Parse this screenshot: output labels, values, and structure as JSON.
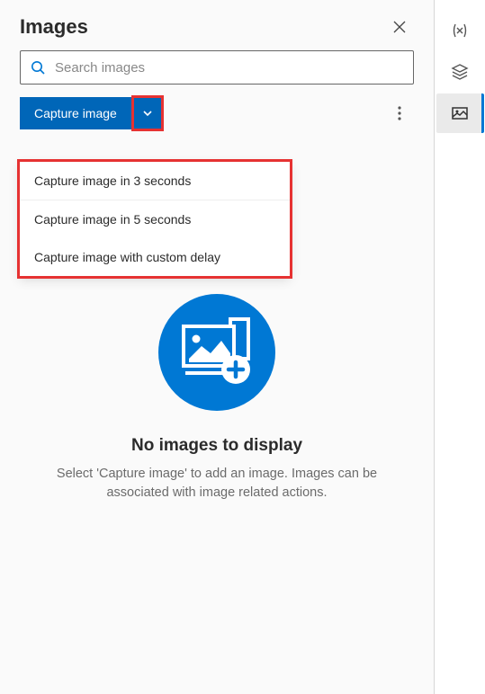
{
  "header": {
    "title": "Images"
  },
  "search": {
    "placeholder": "Search images"
  },
  "toolbar": {
    "capture_label": "Capture image"
  },
  "dropdown": {
    "opt1": "Capture image in 3 seconds",
    "opt2": "Capture image in 5 seconds",
    "opt3": "Capture image with custom delay"
  },
  "empty": {
    "title": "No images to display",
    "subtitle": "Select 'Capture image' to add an image. Images can be associated with image related actions."
  }
}
